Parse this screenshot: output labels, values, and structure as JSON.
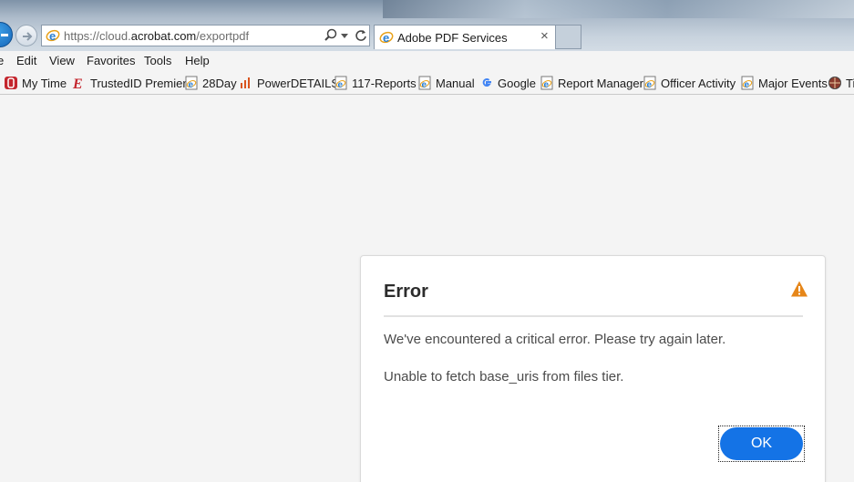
{
  "browser": {
    "url_prefix": "https://cloud.",
    "url_domain": "acrobat.com",
    "url_path": "/exportpdf",
    "tab_title": "Adobe PDF Services",
    "tab_close": "×"
  },
  "menu": {
    "items": [
      "e",
      "Edit",
      "View",
      "Favorites",
      "Tools",
      "Help"
    ]
  },
  "favorites": {
    "items": [
      {
        "label": "My Time",
        "icon": "mytime-icon"
      },
      {
        "label": "TrustedID Premier",
        "icon": "trustedid-icon"
      },
      {
        "label": "28Day",
        "icon": "ie-page-icon"
      },
      {
        "label": "PowerDETAILS",
        "icon": "bar-chart-icon"
      },
      {
        "label": "117-Reports",
        "icon": "ie-page-icon"
      },
      {
        "label": "Manual",
        "icon": "ie-page-icon"
      },
      {
        "label": "Google",
        "icon": "google-icon"
      },
      {
        "label": "Report Manager",
        "icon": "ie-page-icon"
      },
      {
        "label": "Officer Activity",
        "icon": "ie-page-icon"
      },
      {
        "label": "Major Events",
        "icon": "ie-page-icon"
      },
      {
        "label": "Ti",
        "icon": "globe-icon"
      }
    ]
  },
  "dialog": {
    "title": "Error",
    "message": "We've encountered a critical error. Please try again later.",
    "detail": "Unable to fetch base_uris from files tier.",
    "ok_label": "OK",
    "warning_color": "#e68619",
    "button_color": "#1473e6"
  }
}
